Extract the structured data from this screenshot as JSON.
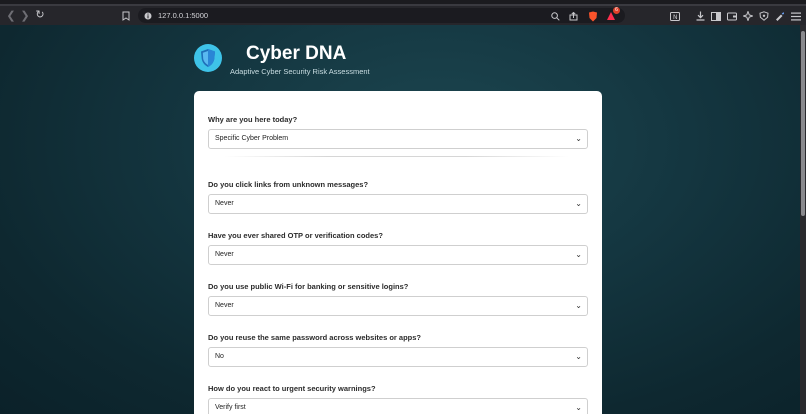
{
  "browser": {
    "url": "127.0.0.1:5000",
    "icons": [
      "back-icon",
      "forward-icon",
      "reload-icon",
      "bookmark-icon",
      "site-info-icon",
      "zoom-icon",
      "share-icon",
      "brave-shield-icon",
      "rewards-icon",
      "tab-search-icon",
      "download-icon",
      "sidebar-icon",
      "wallet-icon",
      "leo-icon",
      "vpn-icon",
      "extensions-icon",
      "menu-icon"
    ],
    "rewards_badge": "6"
  },
  "header": {
    "title": "Cyber DNA",
    "subtitle": "Adaptive Cyber Security Risk Assessment"
  },
  "form": {
    "questions": [
      {
        "label": "Why are you here today?",
        "value": "Specific Cyber Problem"
      },
      {
        "label": "Do you click links from unknown messages?",
        "value": "Never"
      },
      {
        "label": "Have you ever shared OTP or verification codes?",
        "value": "Never"
      },
      {
        "label": "Do you use public Wi-Fi for banking or sensitive logins?",
        "value": "Never"
      },
      {
        "label": "Do you reuse the same password across websites or apps?",
        "value": "No"
      },
      {
        "label": "How do you react to urgent security warnings?",
        "value": "Verify first"
      }
    ]
  },
  "colors": {
    "accent": "#3ec3e8",
    "background": "#143640"
  }
}
